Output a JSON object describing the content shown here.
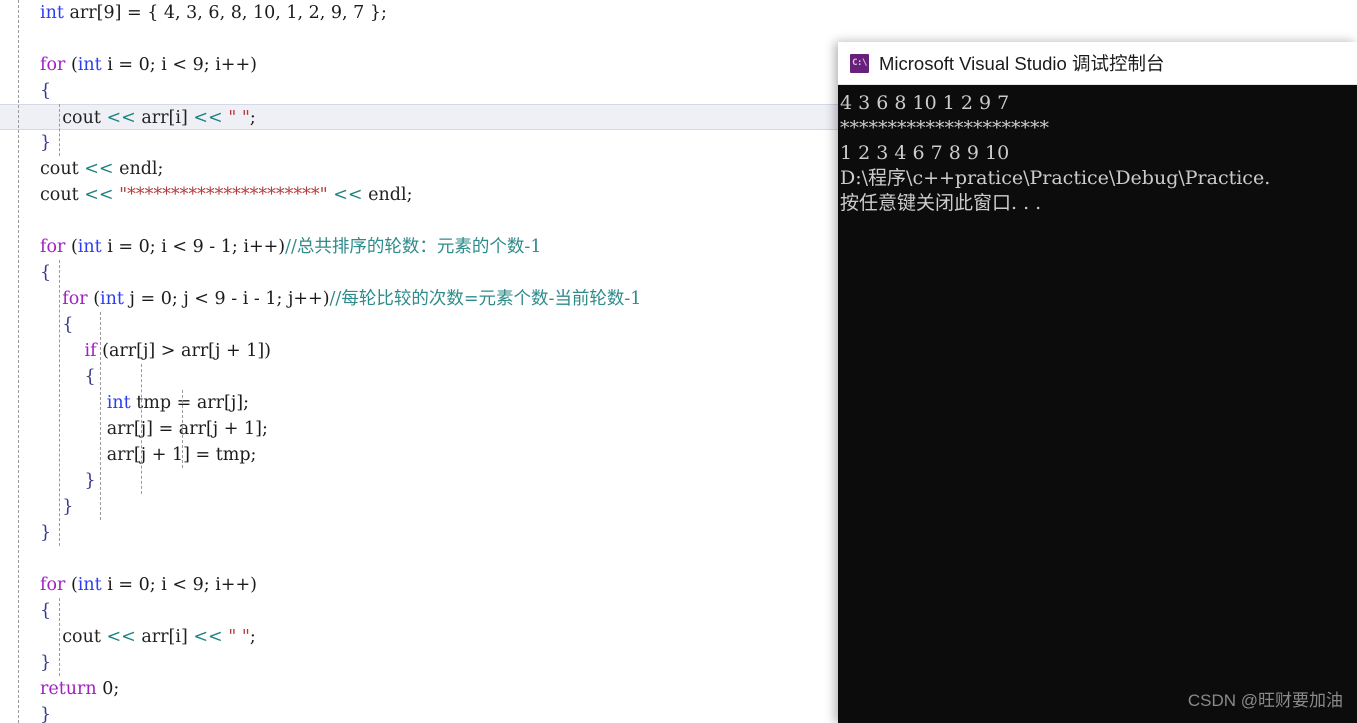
{
  "editor": {
    "name": "code-editor",
    "background": "#ffffff",
    "current_line_number": 5,
    "current_line_highlight_color": "#eef0f6",
    "colors": {
      "keyword": "#a020c0",
      "type": "#2b3ef0",
      "string": "#b33a3a",
      "comment": "#2e8b8b",
      "operator_shift": "#1a7f7f",
      "identifier": "#222222"
    },
    "lines": [
      {
        "indent": 0,
        "tokens": [
          {
            "t": "type",
            "v": "int"
          },
          {
            "t": "id",
            "v": " arr"
          },
          {
            "t": "op",
            "v": "[9] = { 4, 3, 6, 8, 10, 1, 2, 9, 7 };"
          }
        ]
      },
      {
        "indent": 0,
        "tokens": []
      },
      {
        "indent": 0,
        "tokens": [
          {
            "t": "kw",
            "v": "for"
          },
          {
            "t": "op",
            "v": " ("
          },
          {
            "t": "type",
            "v": "int"
          },
          {
            "t": "op",
            "v": " i = 0; i < 9; i++)"
          }
        ]
      },
      {
        "indent": 0,
        "tokens": [
          {
            "t": "brace",
            "v": "{"
          }
        ]
      },
      {
        "indent": 1,
        "tokens": [
          {
            "t": "id",
            "v": "    cout "
          },
          {
            "t": "shift",
            "v": "<<"
          },
          {
            "t": "id",
            "v": " arr[i] "
          },
          {
            "t": "shift",
            "v": "<<"
          },
          {
            "t": "strq",
            "v": " \" \""
          },
          {
            "t": "op",
            "v": ";"
          }
        ]
      },
      {
        "indent": 0,
        "tokens": [
          {
            "t": "brace",
            "v": "}"
          }
        ]
      },
      {
        "indent": 0,
        "tokens": [
          {
            "t": "id",
            "v": "cout "
          },
          {
            "t": "shift",
            "v": "<<"
          },
          {
            "t": "id",
            "v": " endl"
          },
          {
            "t": "op",
            "v": ";"
          }
        ]
      },
      {
        "indent": 0,
        "tokens": [
          {
            "t": "id",
            "v": "cout "
          },
          {
            "t": "shift",
            "v": "<<"
          },
          {
            "t": "strq",
            "v": " \"**********************\""
          },
          {
            "t": "shift",
            "v": " <<"
          },
          {
            "t": "id",
            "v": " endl"
          },
          {
            "t": "op",
            "v": ";"
          }
        ]
      },
      {
        "indent": 0,
        "tokens": []
      },
      {
        "indent": 0,
        "tokens": [
          {
            "t": "kw",
            "v": "for"
          },
          {
            "t": "op",
            "v": " ("
          },
          {
            "t": "type",
            "v": "int"
          },
          {
            "t": "op",
            "v": " i = 0; i < 9 - 1; i++)"
          },
          {
            "t": "cmt",
            "v": "//总共排序的轮数：元素的个数-1"
          }
        ]
      },
      {
        "indent": 0,
        "tokens": [
          {
            "t": "brace",
            "v": "{"
          }
        ]
      },
      {
        "indent": 1,
        "tokens": [
          {
            "t": "op",
            "v": "    "
          },
          {
            "t": "kw",
            "v": "for"
          },
          {
            "t": "op",
            "v": " ("
          },
          {
            "t": "type",
            "v": "int"
          },
          {
            "t": "op",
            "v": " j = 0; j < 9 - i - 1; j++)"
          },
          {
            "t": "cmt",
            "v": "//每轮比较的次数=元素个数-当前轮数-1"
          }
        ]
      },
      {
        "indent": 1,
        "tokens": [
          {
            "t": "brace",
            "v": "    {"
          }
        ]
      },
      {
        "indent": 2,
        "tokens": [
          {
            "t": "op",
            "v": "        "
          },
          {
            "t": "kw",
            "v": "if"
          },
          {
            "t": "op",
            "v": " (arr[j] > arr[j + 1])"
          }
        ]
      },
      {
        "indent": 2,
        "tokens": [
          {
            "t": "brace",
            "v": "        {"
          }
        ]
      },
      {
        "indent": 3,
        "tokens": [
          {
            "t": "op",
            "v": "            "
          },
          {
            "t": "type",
            "v": "int"
          },
          {
            "t": "id",
            "v": " tmp"
          },
          {
            "t": "op",
            "v": " = arr[j];"
          }
        ]
      },
      {
        "indent": 3,
        "tokens": [
          {
            "t": "id",
            "v": "            arr"
          },
          {
            "t": "op",
            "v": "[j] = arr[j + 1];"
          }
        ]
      },
      {
        "indent": 3,
        "tokens": [
          {
            "t": "id",
            "v": "            arr"
          },
          {
            "t": "op",
            "v": "[j + 1] = tmp;"
          }
        ]
      },
      {
        "indent": 2,
        "tokens": [
          {
            "t": "brace",
            "v": "        }"
          }
        ]
      },
      {
        "indent": 1,
        "tokens": [
          {
            "t": "brace",
            "v": "    }"
          }
        ]
      },
      {
        "indent": 0,
        "tokens": [
          {
            "t": "brace",
            "v": "}"
          }
        ]
      },
      {
        "indent": 0,
        "tokens": []
      },
      {
        "indent": 0,
        "tokens": [
          {
            "t": "kw",
            "v": "for"
          },
          {
            "t": "op",
            "v": " ("
          },
          {
            "t": "type",
            "v": "int"
          },
          {
            "t": "op",
            "v": " i = 0; i < 9; i++)"
          }
        ]
      },
      {
        "indent": 0,
        "tokens": [
          {
            "t": "brace",
            "v": "{"
          }
        ]
      },
      {
        "indent": 1,
        "tokens": [
          {
            "t": "id",
            "v": "    cout "
          },
          {
            "t": "shift",
            "v": "<<"
          },
          {
            "t": "id",
            "v": " arr[i] "
          },
          {
            "t": "shift",
            "v": "<<"
          },
          {
            "t": "strq",
            "v": " \" \""
          },
          {
            "t": "op",
            "v": ";"
          }
        ]
      },
      {
        "indent": 0,
        "tokens": [
          {
            "t": "brace",
            "v": "}"
          }
        ]
      },
      {
        "indent": 0,
        "tokens": [
          {
            "t": "kw",
            "v": "return"
          },
          {
            "t": "op",
            "v": " 0;"
          }
        ]
      },
      {
        "indent": 0,
        "tokens": [
          {
            "t": "brace",
            "v": "}"
          }
        ]
      }
    ]
  },
  "console": {
    "title": "Microsoft Visual Studio 调试控制台",
    "icon": "console-app-icon",
    "icon_label": "C:\\",
    "background": "#0c0c0c",
    "text_color": "#cccccc",
    "output_lines": [
      "4 3 6 8 10 1 2 9 7 ",
      "**********************",
      "1 2 3 4 6 7 8 9 10 ",
      "D:\\程序\\c++pratice\\Practice\\Debug\\Practice.",
      "按任意键关闭此窗口. . ."
    ]
  },
  "watermark": {
    "text": "CSDN @旺财要加油"
  }
}
